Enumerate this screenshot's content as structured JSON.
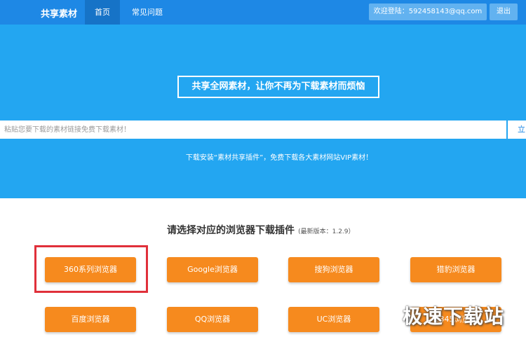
{
  "nav": {
    "brand": "共享素材",
    "tabs": [
      {
        "label": "首页",
        "active": true
      },
      {
        "label": "常见问题",
        "active": false
      }
    ],
    "user_label": "欢迎登陆：592458143@qq.com",
    "logout_label": "退出"
  },
  "hero": {
    "slogan": "共享全网素材，让你不再为下载素材而烦恼",
    "search_placeholder": "粘贴您要下载的素材链接免费下载素材！",
    "search_button": "立",
    "hint": "下载安装“素材共享插件”，免费下载各大素材网站VIP素材！"
  },
  "browsers": {
    "title": "请选择对应的浏览器下载插件",
    "version": "(最新版本：1.2.9）",
    "items": [
      "360系列浏览器",
      "Google浏览器",
      "搜狗浏览器",
      "猎豹浏览器",
      "百度浏览器",
      "QQ浏览器",
      "UC浏览器",
      "2345浏览器"
    ]
  },
  "watermark": "极速下载站",
  "colors": {
    "nav": "#1e88e5",
    "hero": "#23a6f1",
    "button": "#f68a1e",
    "highlight": "#e0303a"
  }
}
